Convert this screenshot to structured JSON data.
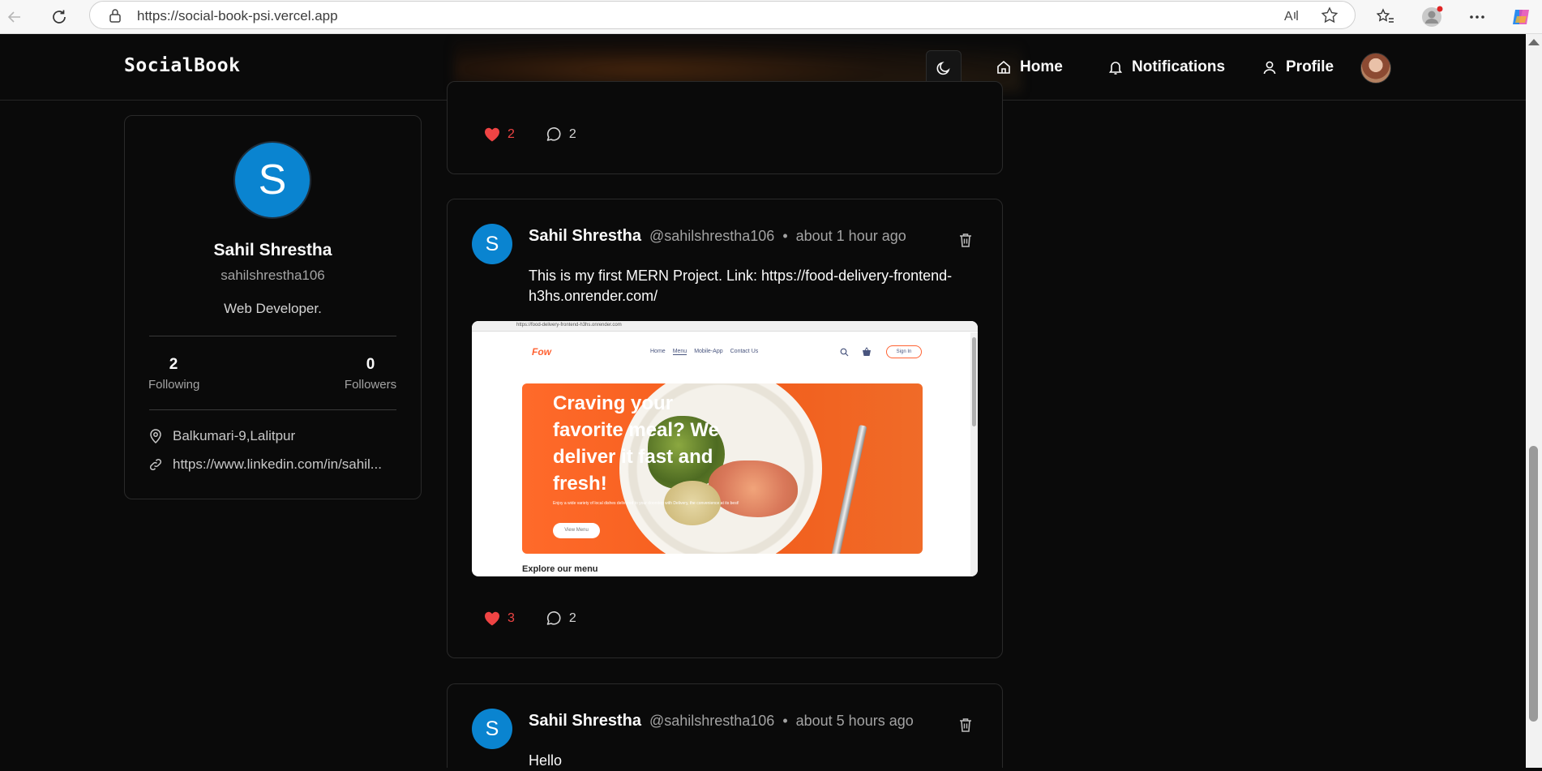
{
  "browser": {
    "url": "https://social-book-psi.vercel.app"
  },
  "app": {
    "brand": "SocialBook",
    "nav": {
      "home": "Home",
      "notifications": "Notifications",
      "profile": "Profile"
    }
  },
  "profile": {
    "avatar_letter": "S",
    "name": "Sahil Shrestha",
    "username": "sahilshrestha106",
    "bio": "Web Developer.",
    "following_count": "2",
    "following_label": "Following",
    "followers_count": "0",
    "followers_label": "Followers",
    "location": "Balkumari-9,Lalitpur",
    "website": "https://www.linkedin.com/in/sahil..."
  },
  "posts": [
    {
      "likes": "2",
      "comments": "2"
    },
    {
      "avatar_letter": "S",
      "author": "Sahil Shrestha",
      "handle": "@sahilshrestha106",
      "separator": "•",
      "time": "about 1 hour ago",
      "text": "This is my first MERN Project. Link: https://food-delivery-frontend-h3hs.onrender.com/",
      "image": {
        "url": "https://food-delivery-frontend-h3hs.onrender.com",
        "menu": [
          "Home",
          "Menu",
          "Mobile-App",
          "Contact Us"
        ],
        "signin": "Sign In",
        "hero_title": "Craving your favorite meal? We deliver it fast and fresh!",
        "hero_subtitle": "Enjoy a wide variety of local dishes delivered to your doorstep with Delivery, the convenience at its best!",
        "hero_button": "View Menu",
        "explore": "Explore our menu"
      },
      "likes": "3",
      "comments": "2"
    },
    {
      "avatar_letter": "S",
      "author": "Sahil Shrestha",
      "handle": "@sahilshrestha106",
      "separator": "•",
      "time": "about 5 hours ago",
      "text": "Hello"
    }
  ],
  "colors": {
    "accent_blue": "#0a84d0",
    "like_red": "#ef4444",
    "background": "#0a0a0a"
  }
}
